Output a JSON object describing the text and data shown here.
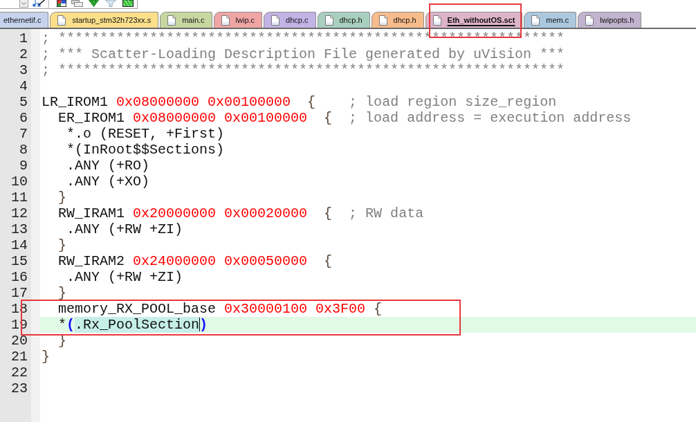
{
  "tabs": [
    {
      "label": "ethernetif.c",
      "color": "#c5d3ee",
      "file_icon": false,
      "selected": false,
      "annotated": false
    },
    {
      "label": "startup_stm32h723xx.s",
      "color": "#fcdf8b",
      "file_icon": true,
      "selected": false,
      "annotated": false
    },
    {
      "label": "main.c",
      "color": "#c8d6a2",
      "file_icon": true,
      "selected": false,
      "annotated": false
    },
    {
      "label": "lwip.c",
      "color": "#f0a5a5",
      "file_icon": true,
      "selected": false,
      "annotated": false
    },
    {
      "label": "dhcp.c",
      "color": "#c2b3e5",
      "file_icon": true,
      "selected": false,
      "annotated": false
    },
    {
      "label": "dhcp.h",
      "color": "#a8cfbf",
      "file_icon": true,
      "selected": false,
      "annotated": false
    },
    {
      "label": "dhcp.h",
      "color": "#f7bc8b",
      "file_icon": true,
      "selected": false,
      "annotated": false
    },
    {
      "label": "Eth_withoutOS.sct",
      "color": "#deb4c8",
      "file_icon": true,
      "selected": true,
      "annotated": true
    },
    {
      "label": "mem.c",
      "color": "#abc8df",
      "file_icon": true,
      "selected": false,
      "annotated": false
    },
    {
      "label": "lwipopts.h",
      "color": "#c2b3cf",
      "file_icon": true,
      "selected": false,
      "annotated": false
    }
  ],
  "lines": [
    {
      "number": "1",
      "current": false,
      "annotated": false,
      "tokens": [
        {
          "kind": "comment",
          "text": "; *************************************************************"
        }
      ]
    },
    {
      "number": "2",
      "current": false,
      "annotated": false,
      "tokens": [
        {
          "kind": "comment",
          "text": "; *** Scatter-Loading Description File generated by uVision ***"
        }
      ]
    },
    {
      "number": "3",
      "current": false,
      "annotated": false,
      "tokens": [
        {
          "kind": "comment",
          "text": "; *************************************************************"
        }
      ]
    },
    {
      "number": "4",
      "current": false,
      "annotated": false
    },
    {
      "number": "5",
      "current": false,
      "annotated": false,
      "tokens": [
        {
          "kind": "plain",
          "text": "LR_IROM1 "
        },
        {
          "kind": "number",
          "text": "0x08000000"
        },
        {
          "kind": "number",
          "text": " 0x00100000"
        },
        {
          "kind": "brace",
          "text": "  {"
        },
        {
          "kind": "comment",
          "text": "    ; load region size_region"
        }
      ]
    },
    {
      "number": "6",
      "current": false,
      "annotated": false,
      "tokens": [
        {
          "kind": "plain",
          "text": "  ER_IROM1 "
        },
        {
          "kind": "number",
          "text": "0x08000000"
        },
        {
          "kind": "number",
          "text": " 0x00100000"
        },
        {
          "kind": "brace",
          "text": "  {"
        },
        {
          "kind": "comment",
          "text": "  ; load address = execution address"
        }
      ]
    },
    {
      "number": "7",
      "current": false,
      "annotated": false,
      "tokens": [
        {
          "kind": "plain",
          "text": "   *.o (RESET, +First)"
        }
      ]
    },
    {
      "number": "8",
      "current": false,
      "annotated": false,
      "tokens": [
        {
          "kind": "plain",
          "text": "   *(InRoot$$Sections)"
        }
      ]
    },
    {
      "number": "9",
      "current": false,
      "annotated": false,
      "tokens": [
        {
          "kind": "plain",
          "text": "   .ANY (+RO)"
        }
      ]
    },
    {
      "number": "10",
      "current": false,
      "annotated": false,
      "tokens": [
        {
          "kind": "plain",
          "text": "   .ANY (+XO)"
        }
      ]
    },
    {
      "number": "11",
      "current": false,
      "annotated": false,
      "tokens": [
        {
          "kind": "brace",
          "text": "  }"
        }
      ]
    },
    {
      "number": "12",
      "current": false,
      "annotated": false,
      "tokens": [
        {
          "kind": "plain",
          "text": "  RW_IRAM1 "
        },
        {
          "kind": "number",
          "text": "0x20000000"
        },
        {
          "kind": "number",
          "text": " 0x00020000"
        },
        {
          "kind": "brace",
          "text": "  {"
        },
        {
          "kind": "comment",
          "text": "  ; RW data"
        }
      ]
    },
    {
      "number": "13",
      "current": false,
      "annotated": false,
      "tokens": [
        {
          "kind": "plain",
          "text": "   .ANY (+RW +ZI)"
        }
      ]
    },
    {
      "number": "14",
      "current": false,
      "annotated": false,
      "tokens": [
        {
          "kind": "brace",
          "text": "  }"
        }
      ]
    },
    {
      "number": "15",
      "current": false,
      "annotated": false,
      "tokens": [
        {
          "kind": "plain",
          "text": "  RW_IRAM2 "
        },
        {
          "kind": "number",
          "text": "0x24000000"
        },
        {
          "kind": "number",
          "text": " 0x00050000"
        },
        {
          "kind": "brace",
          "text": "  {"
        }
      ]
    },
    {
      "number": "16",
      "current": false,
      "annotated": false,
      "tokens": [
        {
          "kind": "plain",
          "text": "   .ANY (+RW +ZI)"
        }
      ]
    },
    {
      "number": "17",
      "current": false,
      "annotated": false,
      "tokens": [
        {
          "kind": "brace",
          "text": "  }"
        }
      ]
    },
    {
      "number": "18",
      "current": false,
      "annotated": true,
      "tokens": [
        {
          "kind": "plain",
          "text": "  memory_RX_POOL_base "
        },
        {
          "kind": "number",
          "text": "0x30000100"
        },
        {
          "kind": "number",
          "text": " 0x3F00"
        },
        {
          "kind": "brace",
          "text": " {"
        }
      ]
    },
    {
      "number": "19",
      "current": true,
      "annotated": true,
      "tokens": [
        {
          "kind": "plain",
          "text": "  *"
        },
        {
          "kind": "match",
          "text": "("
        },
        {
          "kind": "highlight",
          "text": ".Rx_PoolSection",
          "caret_after": true
        },
        {
          "kind": "match",
          "text": ")"
        }
      ]
    },
    {
      "number": "20",
      "current": false,
      "annotated": false,
      "tokens": [
        {
          "kind": "brace",
          "text": "  }"
        }
      ]
    },
    {
      "number": "21",
      "current": false,
      "annotated": false,
      "tokens": [
        {
          "kind": "brace",
          "text": "}"
        }
      ]
    },
    {
      "number": "22",
      "current": false,
      "annotated": false
    },
    {
      "number": "23",
      "current": false,
      "annotated": false
    }
  ]
}
